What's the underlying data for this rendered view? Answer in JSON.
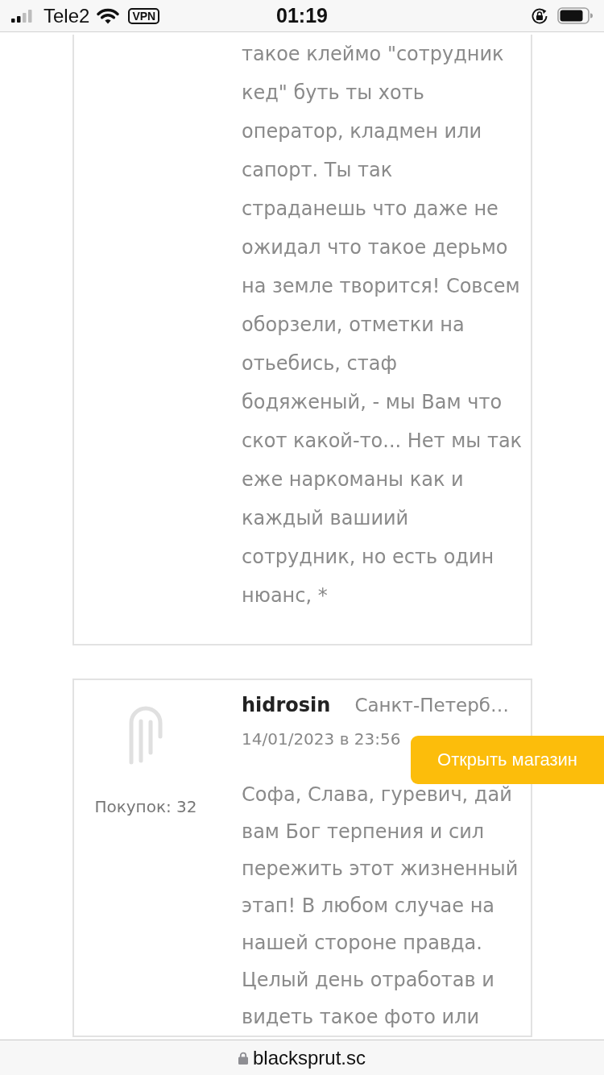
{
  "status_bar": {
    "carrier": "Tele2",
    "vpn": "VPN",
    "time": "01:19"
  },
  "reviews": [
    {
      "text": "такое клеймо \"сотрудник кед\" буть ты хоть оператор, кладмен или сапорт. Ты так страданешь что даже не ожидал что такое дерьмо на земле творится! Совсем оборзели, отметки на отьебись, стаф бодяженый, - мы Вам что скот какой-то... Нет мы так еже наркоманы как и каждый вашиий сотрудник, но есть один нюанс, *"
    },
    {
      "author": "hidrosin",
      "city": "Санкт-Петерб…",
      "date": "14/01/2023 в 23:56",
      "purchases": "Покупок: 32",
      "text": "Софа, Слава, гуревич, дай вам Бог терпения и сил пережить этот жизненный этап! В любом случае на нашей стороне правда. Целый день отработав и видеть такое фото или"
    }
  ],
  "open_shop_button": "Открыть магазин",
  "address_bar": {
    "url": "blacksprut.sc"
  }
}
